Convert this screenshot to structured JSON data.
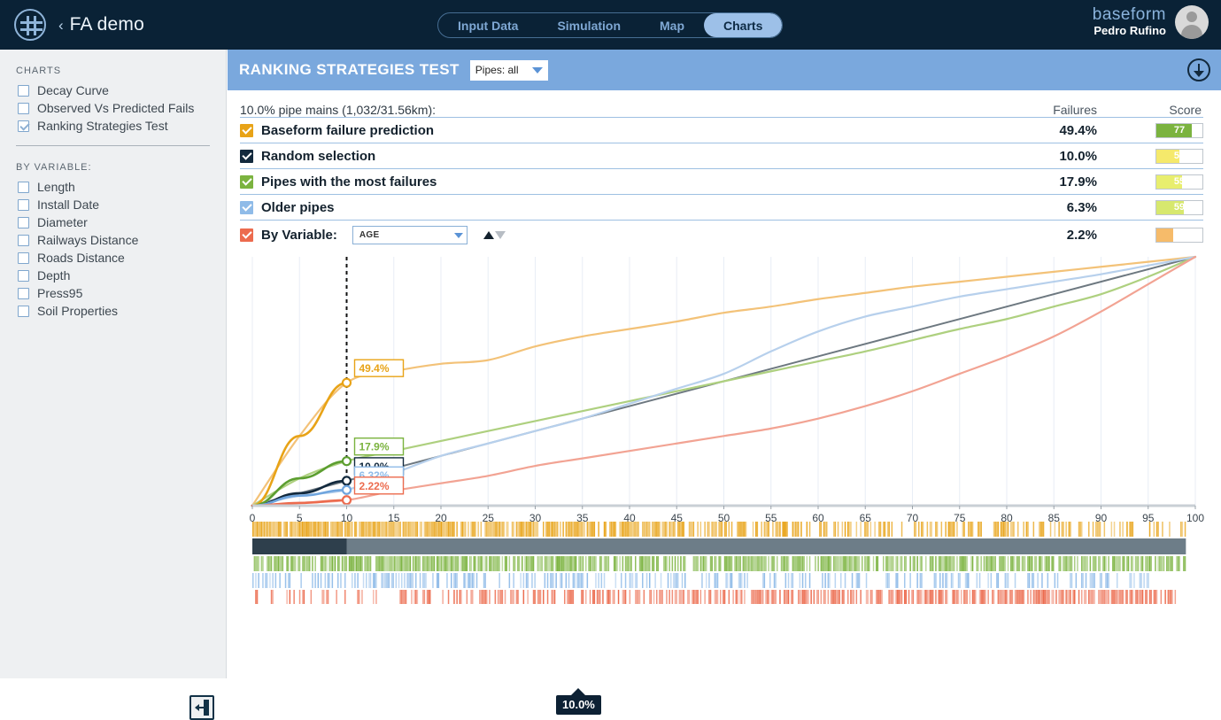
{
  "topbar": {
    "logo_icon": "baseform-logo-icon",
    "back_chevron": "‹",
    "project_name": "FA demo",
    "tabs": [
      {
        "label": "Input Data",
        "active": false
      },
      {
        "label": "Simulation",
        "active": false
      },
      {
        "label": "Map",
        "active": false
      },
      {
        "label": "Charts",
        "active": true
      }
    ],
    "brand": "baseform",
    "user": "Pedro Rufino",
    "avatar_icon": "user-avatar-icon"
  },
  "sidebar": {
    "charts_header": "CHARTS",
    "charts": [
      {
        "label": "Decay Curve",
        "checked": false
      },
      {
        "label": "Observed Vs Predicted Fails",
        "checked": false
      },
      {
        "label": "Ranking Strategies Test",
        "checked": true
      }
    ],
    "byvariable_header": "BY VARIABLE:",
    "variables": [
      {
        "label": "Length",
        "checked": false
      },
      {
        "label": "Install Date",
        "checked": false
      },
      {
        "label": "Diameter",
        "checked": false
      },
      {
        "label": "Railways Distance",
        "checked": false
      },
      {
        "label": "Roads Distance",
        "checked": false
      },
      {
        "label": "Depth",
        "checked": false
      },
      {
        "label": "Press95",
        "checked": false
      },
      {
        "label": "Soil Properties",
        "checked": false
      }
    ],
    "collapse_icon": "collapse-sidebar-icon"
  },
  "panel": {
    "title": "RANKING STRATEGIES TEST",
    "pipes_filter": "Pipes: all",
    "download_icon": "download-icon",
    "caption": "10.0% pipe mains (1,032/31.56km):",
    "col_failures": "Failures",
    "col_score": "Score",
    "byvariable_label": "By Variable:",
    "byvariable_value": "AGE",
    "sort_asc_icon": "sort-ascending-icon",
    "sort_desc_icon": "sort-descending-icon",
    "rows": [
      {
        "name": "Baseform failure prediction",
        "failures": "49.4%",
        "score": "77",
        "color": "#e8a317",
        "fill": "#7bb33f",
        "checked": true
      },
      {
        "name": "Random selection",
        "failures": "10.0%",
        "score": "50",
        "color": "#12293d",
        "fill": "#f5e96b",
        "checked": true
      },
      {
        "name": "Pipes with the most failures",
        "failures": "17.9%",
        "score": "55",
        "color": "#7bb33f",
        "fill": "#e8ee6e",
        "checked": true
      },
      {
        "name": "Older pipes",
        "failures": "6.3%",
        "score": "59",
        "color": "#8fbbe8",
        "fill": "#d7e86e",
        "checked": true
      },
      {
        "name": "By Variable:",
        "failures": "2.2%",
        "score": "37",
        "color": "#ec6b4e",
        "fill": "#f6bb6a",
        "checked": true
      }
    ]
  },
  "chart_data": {
    "type": "line",
    "title": "",
    "xlabel": "",
    "ylabel": "",
    "xlim": [
      0,
      100
    ],
    "ylim": [
      0,
      100
    ],
    "grid": true,
    "legend": "none",
    "xticks": [
      0,
      5,
      10,
      15,
      20,
      25,
      30,
      35,
      40,
      45,
      50,
      55,
      60,
      65,
      70,
      75,
      80,
      85,
      90,
      95,
      100
    ],
    "marker_x": 10,
    "marker_tooltip": "10.0%",
    "annotations": [
      {
        "text": "49.4%",
        "color": "#e8a317",
        "x": 10,
        "y": 49.4
      },
      {
        "text": "17.9%",
        "color": "#7bb33f",
        "x": 10,
        "y": 17.9
      },
      {
        "text": "10.0%",
        "color": "#12293d",
        "x": 10,
        "y": 10.0
      },
      {
        "text": "6.32%",
        "color": "#8fbbe8",
        "x": 10,
        "y": 6.32
      },
      {
        "text": "2.22%",
        "color": "#ec6b4e",
        "x": 10,
        "y": 2.22
      }
    ],
    "x": [
      0,
      5,
      10,
      15,
      20,
      25,
      30,
      35,
      40,
      45,
      50,
      55,
      60,
      65,
      70,
      75,
      80,
      85,
      90,
      95,
      100
    ],
    "series": [
      {
        "name": "Baseform failure prediction",
        "color": "#f3c278",
        "values": [
          0,
          28,
          49.4,
          54,
          57,
          58.5,
          64,
          68,
          71,
          74,
          77.5,
          80,
          83,
          85.5,
          88,
          90,
          92,
          94,
          96,
          98,
          100
        ]
      },
      {
        "name": "Random selection",
        "color": "#6d7880",
        "values": [
          0,
          5,
          10,
          15,
          20,
          25,
          30,
          35,
          40,
          45,
          50,
          55,
          60,
          65,
          70,
          75,
          80,
          85,
          90,
          95,
          100
        ]
      },
      {
        "name": "Pipes with the most failures",
        "color": "#aed07f",
        "values": [
          0,
          11,
          17.9,
          22,
          26,
          30,
          34,
          38,
          42,
          46,
          50,
          54,
          58,
          62,
          66.5,
          71,
          75,
          80,
          85,
          92,
          100
        ]
      },
      {
        "name": "Older pipes",
        "color": "#b7d0ec",
        "values": [
          0,
          4,
          6.32,
          13,
          20,
          25,
          30,
          35,
          41,
          47,
          53,
          62,
          70,
          76,
          80,
          84,
          87,
          90,
          93,
          96.5,
          100
        ]
      },
      {
        "name": "By Variable (AGE)",
        "color": "#f2a393",
        "values": [
          0,
          1.1,
          2.22,
          6,
          9,
          12,
          16,
          19,
          22,
          25,
          28,
          31,
          35,
          40,
          46,
          53,
          60,
          68,
          78,
          89,
          100
        ]
      }
    ],
    "strips": [
      {
        "name": "baseform-strip",
        "color": "#e8a317",
        "end": 99
      },
      {
        "name": "random-strip",
        "color": "#4e5d68",
        "end": 99
      },
      {
        "name": "most-failures-strip",
        "color": "#7bb33f",
        "end": 99
      },
      {
        "name": "older-pipes-strip",
        "color": "#8fbbe8",
        "end": 95
      },
      {
        "name": "by-variable-strip",
        "color": "#ec6b4e",
        "end": 98
      }
    ]
  }
}
